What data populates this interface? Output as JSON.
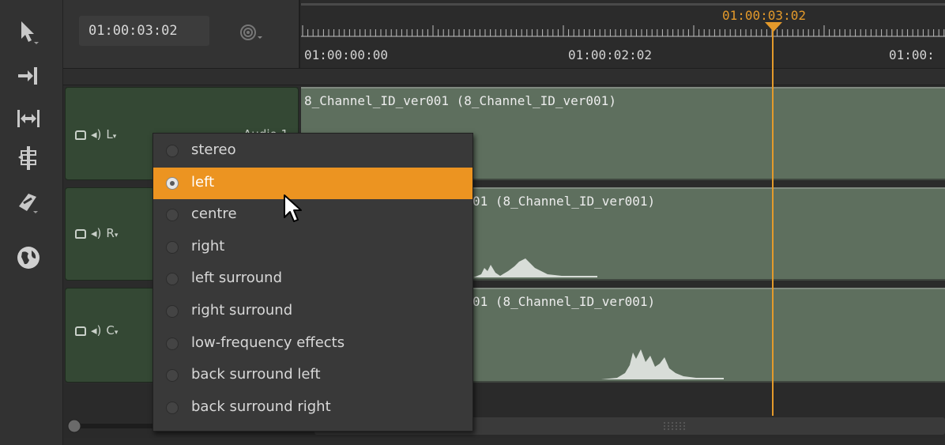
{
  "toolbar": {
    "tools": [
      {
        "icon": "pointer-arrow-icon"
      },
      {
        "icon": "ripple-edit-icon"
      },
      {
        "icon": "roll-edit-icon"
      },
      {
        "icon": "slip-edit-icon"
      },
      {
        "icon": "razor-icon"
      },
      {
        "icon": "globe-icon"
      }
    ]
  },
  "header": {
    "timecode": "01:00:03:02",
    "snap_icon": "snap-target-icon"
  },
  "ruler": {
    "playhead_timecode": "01:00:03:02",
    "labels": [
      "01:00:00:00",
      "01:00:02:02",
      "01:00:"
    ]
  },
  "tracks": [
    {
      "channel": "L",
      "name": "Audio 1",
      "clip_title": "8_Channel_ID_ver001 (8_Channel_ID_ver001)"
    },
    {
      "channel": "R",
      "name": "",
      "clip_title": "01 (8_Channel_ID_ver001)"
    },
    {
      "channel": "C",
      "name": "",
      "clip_title": "01 (8_Channel_ID_ver001)"
    }
  ],
  "menu": {
    "items": [
      {
        "label": "stereo",
        "selected": false
      },
      {
        "label": "left",
        "selected": true
      },
      {
        "label": "centre",
        "selected": false
      },
      {
        "label": "right",
        "selected": false
      },
      {
        "label": "left surround",
        "selected": false
      },
      {
        "label": "right surround",
        "selected": false
      },
      {
        "label": "low-frequency effects",
        "selected": false
      },
      {
        "label": "back surround left",
        "selected": false
      },
      {
        "label": "back surround right",
        "selected": false
      }
    ]
  },
  "colors": {
    "accent": "#ec9421",
    "playhead": "#e49a2b",
    "track_header": "#344834",
    "clip": "#5e6f5e"
  }
}
